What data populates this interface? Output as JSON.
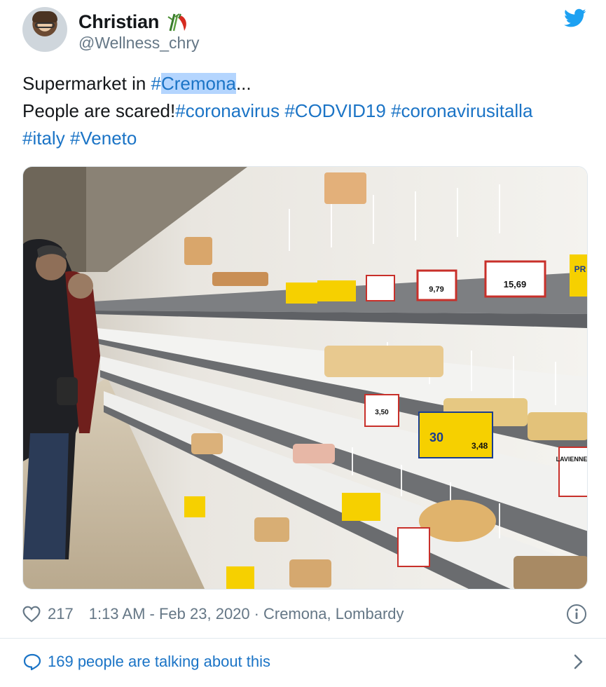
{
  "tweet": {
    "author": {
      "display_name": "Christian",
      "handle": "@Wellness_chry",
      "emoji": "bamboo-chili-pepper-icon"
    },
    "text": {
      "line1_prefix": "Supermarket in ",
      "line1_hashtag": "#",
      "line1_hashtag_highlight": "Cremona",
      "line1_suffix": "...",
      "line2_prefix": "People are scared!",
      "hashtags_line2": [
        "#coronavirus",
        "#CODVID19",
        "#coronavirusitalla"
      ],
      "hashtags_line3": [
        "#italy",
        "#Veneto"
      ]
    },
    "photo": {
      "price_tags": [
        "15,69",
        "9,79",
        "3,48",
        "3,50",
        "30"
      ],
      "brand_tags": [
        "LAVIENNES",
        "PR"
      ]
    },
    "meta": {
      "likes": "217",
      "timestamp": "1:13 AM - Feb 23, 2020",
      "separator": "·",
      "location": "Cremona, Lombardy"
    },
    "talking": "169 people are talking about this"
  },
  "colors": {
    "link": "#1b74c6",
    "muted": "#657786",
    "twitter_blue": "#1da1f2",
    "highlight": "#b4d5fe"
  },
  "icons": [
    "twitter-bird-icon",
    "heart-icon",
    "info-icon",
    "speech-bubble-icon",
    "chevron-right-icon"
  ]
}
